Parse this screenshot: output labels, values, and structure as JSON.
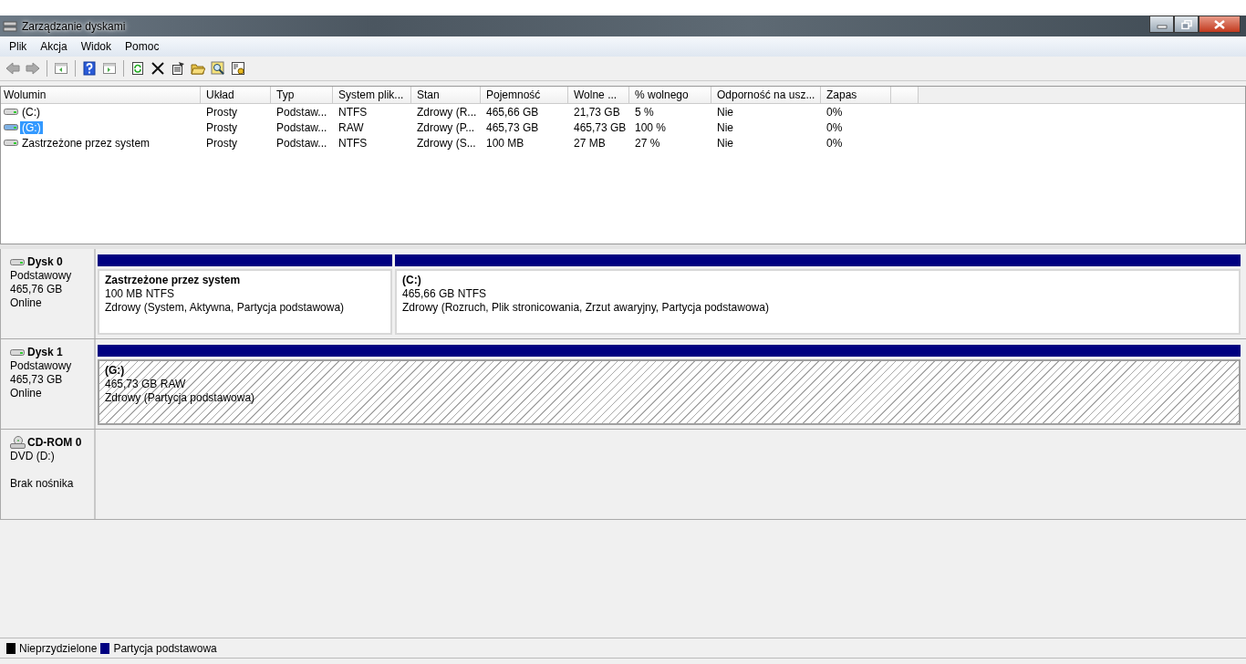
{
  "window": {
    "title": "Zarządzanie dyskami"
  },
  "menu": [
    "Plik",
    "Akcja",
    "Widok",
    "Pomoc"
  ],
  "table": {
    "columns": [
      "Wolumin",
      "Układ",
      "Typ",
      "System plik...",
      "Stan",
      "Pojemność",
      "Wolne ...",
      "% wolnego",
      "Odporność na usz...",
      "Zapas"
    ],
    "rows": [
      {
        "selected": false,
        "cells": [
          "(C:)",
          "Prosty",
          "Podstaw...",
          "NTFS",
          "Zdrowy (R...",
          "465,66 GB",
          "21,73 GB",
          "5 %",
          "Nie",
          "0%"
        ]
      },
      {
        "selected": true,
        "cells": [
          "(G:)",
          "Prosty",
          "Podstaw...",
          "RAW",
          "Zdrowy (P...",
          "465,73 GB",
          "465,73 GB",
          "100 %",
          "Nie",
          "0%"
        ]
      },
      {
        "selected": false,
        "cells": [
          "Zastrzeżone przez system",
          "Prosty",
          "Podstaw...",
          "NTFS",
          "Zdrowy (S...",
          "100 MB",
          "27 MB",
          "27 %",
          "Nie",
          "0%"
        ]
      }
    ]
  },
  "disks": [
    {
      "kind": "disk",
      "name": "Dysk 0",
      "lines": [
        "Podstawowy",
        "465,76 GB",
        "Online"
      ],
      "partitions": [
        {
          "selected": false,
          "title": "Zastrzeżone przez system",
          "size": "100 MB NTFS",
          "status": "Zdrowy (System, Aktywna, Partycja podstawowa)"
        },
        {
          "selected": false,
          "title": "(C:)",
          "size": "465,66 GB NTFS",
          "status": "Zdrowy (Rozruch, Plik stronicowania, Zrzut awaryjny, Partycja podstawowa)"
        }
      ]
    },
    {
      "kind": "disk",
      "name": "Dysk 1",
      "lines": [
        "Podstawowy",
        "465,73 GB",
        "Online"
      ],
      "partitions": [
        {
          "selected": true,
          "title": "(G:)",
          "size": "465,73 GB RAW",
          "status": "Zdrowy (Partycja podstawowa)"
        }
      ]
    },
    {
      "kind": "cdrom",
      "name": "CD-ROM 0",
      "lines": [
        "DVD (D:)",
        "Brak nośnika"
      ]
    }
  ],
  "legend": [
    {
      "label": "Nieprzydzielone",
      "color": "#000000"
    },
    {
      "label": "Partycja podstawowa",
      "color": "#000080"
    }
  ]
}
